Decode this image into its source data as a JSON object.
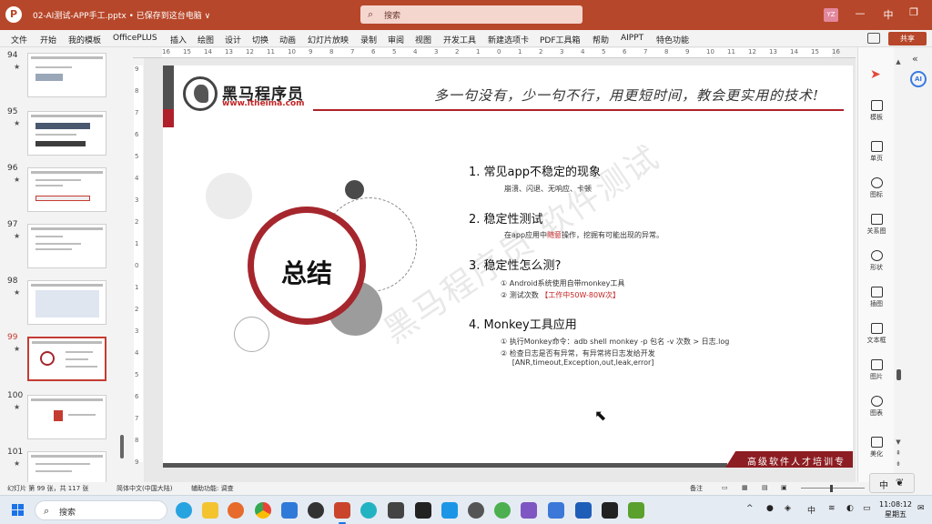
{
  "titlebar": {
    "document_title": "02-AI测试-APP手工.pptx • 已保存到这台电脑 ∨",
    "search_placeholder": "搜索",
    "user_initials": "YZ",
    "minimize": "—",
    "restore": "中",
    "maximize": "❐",
    "close": "✕"
  },
  "menu": {
    "items": [
      "文件",
      "开始",
      "我的模板",
      "OfficePLUS",
      "插入",
      "绘图",
      "设计",
      "切换",
      "动画",
      "幻灯片放映",
      "录制",
      "审阅",
      "视图",
      "开发工具",
      "新建选项卡",
      "PDF工具箱",
      "帮助",
      "AIPPT",
      "特色功能"
    ],
    "share": "共享"
  },
  "thumbnails": [
    {
      "number": "94",
      "star": "★"
    },
    {
      "number": "95",
      "star": "★"
    },
    {
      "number": "96",
      "star": "★"
    },
    {
      "number": "97",
      "star": "★"
    },
    {
      "number": "98",
      "star": "★"
    },
    {
      "number": "99",
      "star": "★"
    },
    {
      "number": "100",
      "star": "★"
    },
    {
      "number": "101",
      "star": "★"
    }
  ],
  "ruler_top": {
    "labels": [
      "16",
      "15",
      "14",
      "13",
      "12",
      "11",
      "10",
      "9",
      "8",
      "7",
      "6",
      "5",
      "4",
      "3",
      "2",
      "1",
      "0",
      "1",
      "2",
      "3",
      "4",
      "5",
      "6",
      "7",
      "8",
      "9",
      "10",
      "11",
      "12",
      "13",
      "14",
      "15",
      "16"
    ]
  },
  "ruler_left": {
    "labels": [
      "9",
      "8",
      "7",
      "6",
      "5",
      "4",
      "3",
      "2",
      "1",
      "0",
      "1",
      "2",
      "3",
      "4",
      "5",
      "6",
      "7",
      "8",
      "9"
    ]
  },
  "slide": {
    "brand_name": "黑马程序员",
    "brand_url": "www.itheima.com",
    "slogan": "多一句没有，少一句不行，用更短时间，教会更实用的技术!",
    "center_title": "总结",
    "watermark": "黑马程序员·软件测试",
    "banner": "高级软件人才培训专",
    "points": [
      {
        "heading": "1.  常见app不稳定的现象",
        "lines": [
          {
            "pre": "崩溃、闪退、无响应、卡顿",
            "red": "",
            "post": ""
          }
        ]
      },
      {
        "heading": "2.  稳定性测试",
        "lines": [
          {
            "pre": "在app应用中",
            "red": "随意",
            "post": "操作，挖掘有可能出现的异常。"
          }
        ]
      },
      {
        "heading": "3.  稳定性怎么测?",
        "lines": [
          {
            "pre": "①  Android系统使用自带monkey工具",
            "red": "",
            "post": ""
          },
          {
            "pre": "②  测试次数 ",
            "red": "【工作中50W-80W次】",
            "post": ""
          }
        ]
      },
      {
        "heading": "4.  Monkey工具应用",
        "lines": [
          {
            "pre": "①  执行Monkey命令：adb shell monkey -p 包名 -v  次数 > 日志.log",
            "red": "",
            "post": ""
          },
          {
            "pre": "②  检查日志是否有异常，有异常将日志发给开发",
            "red": "",
            "post": ""
          },
          {
            "pre": "     [ANR,timeout,Exception,out,leak,error]",
            "red": "",
            "post": ""
          }
        ]
      }
    ]
  },
  "right_panel": [
    "模板",
    "单页",
    "图标",
    "关系图",
    "形状",
    "插图",
    "文本框",
    "图片",
    "图表",
    "美化"
  ],
  "statusbar": {
    "slide_info": "幻灯片 第 99 张，共 117 张",
    "language": "简体中文(中国大陆)",
    "accessibility": "辅助功能: 调查",
    "notes": "备注",
    "ime_mode": "中"
  },
  "taskbar": {
    "search_placeholder": "搜索",
    "time": "11:08:12",
    "date": "星期五"
  }
}
